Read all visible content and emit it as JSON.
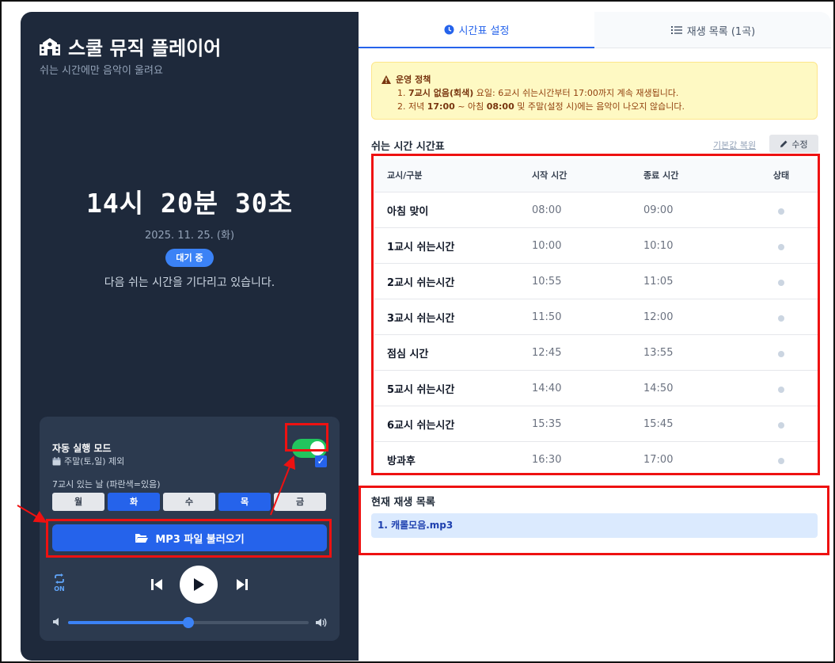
{
  "app": {
    "title": "스쿨 뮤직 플레이어",
    "subtitle": "쉬는 시간에만 음악이 울려요",
    "clock": "14시 20분 30초",
    "date": "2025. 11. 25. (화)",
    "status_badge": "대기 중",
    "status_message": "다음 쉬는 시간을 기다리고 있습니다."
  },
  "controls": {
    "auto_mode_label": "자동 실행 모드",
    "auto_mode_on": true,
    "weekend_label": "주말(토,일) 제외",
    "weekend_checked": true,
    "seven_period_label": "7교시 있는 날 (파란색=있음)",
    "days": [
      {
        "label": "월",
        "active": false
      },
      {
        "label": "화",
        "active": true
      },
      {
        "label": "수",
        "active": false
      },
      {
        "label": "목",
        "active": true
      },
      {
        "label": "금",
        "active": false
      }
    ],
    "mp3_button": "MP3 파일 불러오기",
    "repeat_label": "ON",
    "volume": 0.5
  },
  "tabs": {
    "schedule": "시간표 설정",
    "playlist": "재생 목록 (1곡)"
  },
  "policy": {
    "title": "운영 정책",
    "line1_prefix": "1. ",
    "line1_bold": "7교시 없음(회색)",
    "line1_rest": " 요일: 6교시 쉬는시간부터 17:00까지 계속 재생됩니다.",
    "line2_prefix": "2. 저녁 ",
    "line2_bold1": "17:00",
    "line2_mid": " ~ 아침 ",
    "line2_bold2": "08:00",
    "line2_rest": " 및 주말(설정 시)에는 음악이 나오지 않습니다."
  },
  "schedule": {
    "title": "쉬는 시간 시간표",
    "reset_label": "기본값 복원",
    "edit_label": "수정",
    "headers": [
      "교시/구분",
      "시작 시간",
      "종료 시간",
      "상태"
    ],
    "rows": [
      {
        "name": "아침 맞이",
        "start": "08:00",
        "end": "09:00"
      },
      {
        "name": "1교시 쉬는시간",
        "start": "10:00",
        "end": "10:10"
      },
      {
        "name": "2교시 쉬는시간",
        "start": "10:55",
        "end": "11:05"
      },
      {
        "name": "3교시 쉬는시간",
        "start": "11:50",
        "end": "12:00"
      },
      {
        "name": "점심 시간",
        "start": "12:45",
        "end": "13:55"
      },
      {
        "name": "5교시 쉬는시간",
        "start": "14:40",
        "end": "14:50"
      },
      {
        "name": "6교시 쉬는시간",
        "start": "15:35",
        "end": "15:45"
      },
      {
        "name": "방과후",
        "start": "16:30",
        "end": "17:00"
      }
    ]
  },
  "playlist": {
    "title": "현재 재생 목록",
    "items": [
      "1. 캐롤모음.mp3"
    ]
  },
  "colors": {
    "panel_bg": "#1e293b",
    "accent": "#2563eb",
    "toggle_on": "#22c55e",
    "annotation": "#ee1111"
  }
}
